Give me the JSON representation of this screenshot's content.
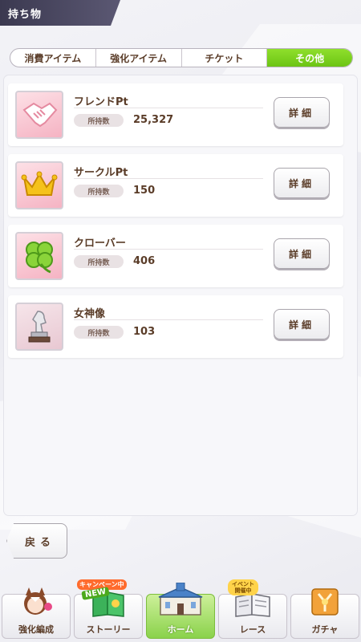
{
  "header": {
    "title": "持ち物"
  },
  "tabs": [
    {
      "label": "消費アイテム",
      "active": false
    },
    {
      "label": "強化アイテム",
      "active": false
    },
    {
      "label": "チケット",
      "active": false
    },
    {
      "label": "その他",
      "active": true
    }
  ],
  "items": [
    {
      "name": "フレンドPt",
      "owned_label": "所持数",
      "owned": "25,327",
      "detail_label": "詳細",
      "icon": "handshake-icon"
    },
    {
      "name": "サークルPt",
      "owned_label": "所持数",
      "owned": "150",
      "detail_label": "詳細",
      "icon": "crown-icon"
    },
    {
      "name": "クローバー",
      "owned_label": "所持数",
      "owned": "406",
      "detail_label": "詳細",
      "icon": "clover-icon"
    },
    {
      "name": "女神像",
      "owned_label": "所持数",
      "owned": "103",
      "detail_label": "詳細",
      "icon": "goddess-statue-icon"
    }
  ],
  "back_label": "戻る",
  "nav": [
    {
      "label": "強化編成",
      "icon": "horse-girl-icon"
    },
    {
      "label": "ストーリー",
      "icon": "story-book-icon",
      "badge_new": "NEW",
      "badge_campaign": "キャンペーン中"
    },
    {
      "label": "ホーム",
      "icon": "home-building-icon"
    },
    {
      "label": "レース",
      "icon": "race-book-icon",
      "badge_event": "イベント開催中"
    },
    {
      "label": "ガチャ",
      "icon": "gacha-icon"
    }
  ],
  "colors": {
    "accent_green": "#6cc414",
    "text_brown": "#5a3c28",
    "icon_pink": "#f5b3c3"
  }
}
